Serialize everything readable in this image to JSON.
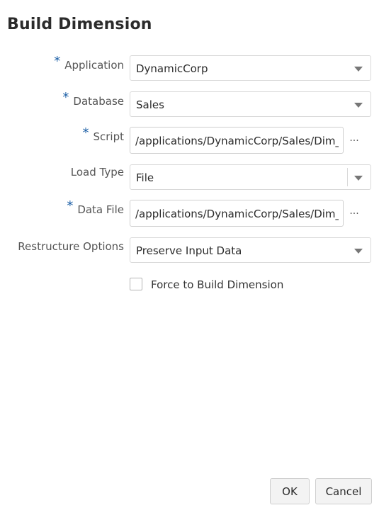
{
  "dialog": {
    "title": "Build Dimension"
  },
  "form": {
    "application": {
      "label": "Application",
      "required_marker": "*",
      "value": "DynamicCorp"
    },
    "database": {
      "label": "Database",
      "required_marker": "*",
      "value": "Sales"
    },
    "script": {
      "label": "Script",
      "required_marker": "*",
      "value": "/applications/DynamicCorp/Sales/Dim_",
      "browse": "···"
    },
    "load_type": {
      "label": "Load Type",
      "value": "File"
    },
    "data_file": {
      "label": "Data File",
      "required_marker": "*",
      "value": "/applications/DynamicCorp/Sales/Dim_",
      "browse": "···"
    },
    "restructure_options": {
      "label": "Restructure Options",
      "value": "Preserve Input Data"
    },
    "force_build": {
      "label": "Force to Build Dimension",
      "checked": false
    }
  },
  "buttons": {
    "ok": "OK",
    "cancel": "Cancel"
  },
  "colors": {
    "required": "#1c5fa6",
    "border": "#d9d9d9",
    "button_bg": "#f3f3f3"
  }
}
